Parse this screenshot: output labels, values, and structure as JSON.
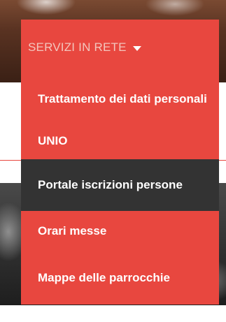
{
  "menu": {
    "trigger_label": "SERVIZI IN RETE",
    "items": [
      {
        "label": "Trattamento dei dati personali"
      },
      {
        "label": "UNIO"
      },
      {
        "label": "Portale iscrizioni persone",
        "highlighted": true
      },
      {
        "label": "Orari messe"
      },
      {
        "label": "Mappe delle parrocchie"
      }
    ]
  },
  "colors": {
    "menu_background": "#e8473f",
    "highlight_background": "#333333",
    "trigger_text": "#f3c6bd",
    "item_text": "#ffffff"
  },
  "icons": {
    "trigger": "caret-down-icon"
  }
}
